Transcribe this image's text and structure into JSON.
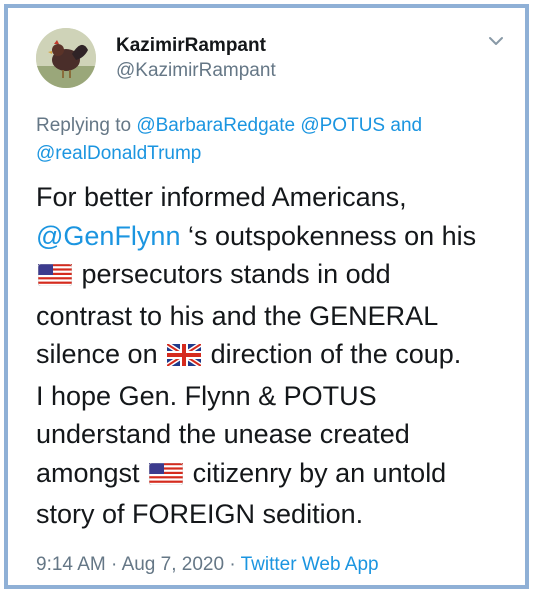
{
  "tweet": {
    "display_name": "KazimirRampant",
    "handle": "@KazimirRampant",
    "replying_prefix": "Replying to",
    "replying_to": [
      "@BarbaraRedgate",
      "@POTUS",
      "@realDonaldTrump"
    ],
    "replying_and": "and",
    "body": {
      "line1": "For better informed Americans,",
      "mention": "@GenFlynn",
      "line2_rest": " ‘s outspokenness on his",
      "line3_rest": " persecutors stands in odd",
      "line4": "contrast to his and the GENERAL",
      "line5_pre": "silence on ",
      "line5_post": " direction of the coup.",
      "line6": "I hope Gen. Flynn & POTUS",
      "line7": "understand the unease created",
      "line8_pre": "amongst ",
      "line8_post": " citizenry by an untold",
      "line9": "story of FOREIGN sedition."
    },
    "time": "9:14 AM",
    "date": "Aug 7, 2020",
    "separator": "·",
    "source": "Twitter Web App"
  },
  "icons": {
    "avatar": "rooster-avatar",
    "menu": "chevron-down-icon",
    "flags": [
      "us-flag-icon",
      "uk-flag-icon",
      "us-flag-icon"
    ]
  },
  "colors": {
    "link": "#1b95e0",
    "secondary_text": "#657786",
    "primary_text": "#14171a",
    "frame_border": "#8fb0d6"
  }
}
